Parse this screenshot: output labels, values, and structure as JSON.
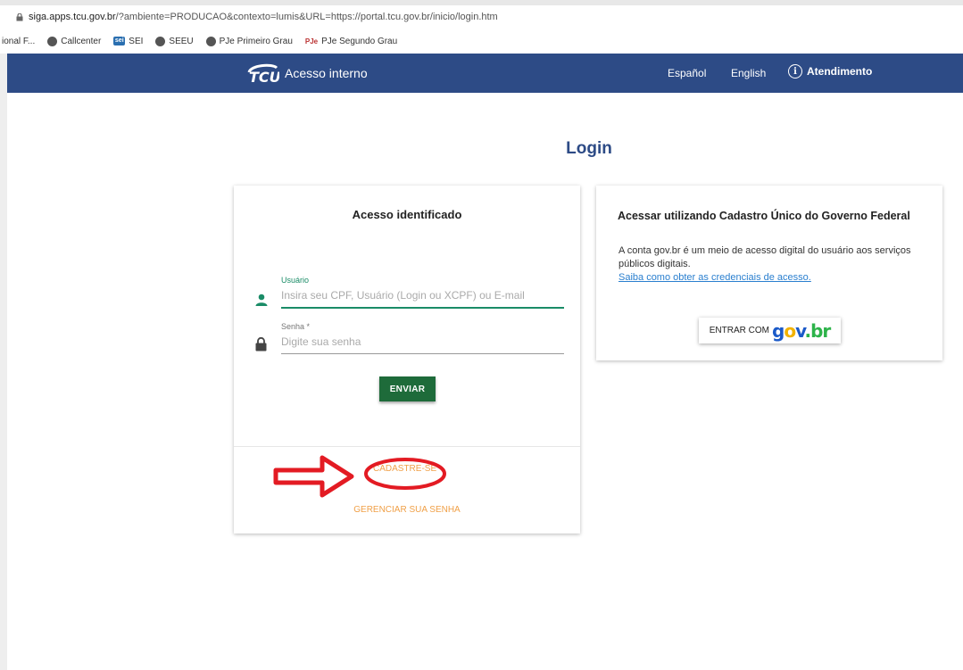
{
  "browser": {
    "url_host": "siga.apps.tcu.gov.br",
    "url_rest": "/?ambiente=PRODUCAO&contexto=lumis&URL=https://portal.tcu.gov.br/inicio/login.htm",
    "bookmarks": [
      "ional F...",
      "Callcenter",
      "SEI",
      "SEEU",
      "PJe Primeiro Grau",
      "PJe Segundo Grau"
    ]
  },
  "header": {
    "brand_text": "Acesso interno",
    "nav_es": "Español",
    "nav_en": "English",
    "nav_atendimento": "Atendimento",
    "color": "#2d4b86"
  },
  "page_title": "Login",
  "login_card": {
    "title": "Acesso identificado",
    "user_label": "Usuário",
    "user_placeholder": "Insira seu CPF, Usuário (Login ou XCPF) ou E-mail",
    "password_label": "Senha *",
    "password_placeholder": "Digite sua senha",
    "submit_label": "ENVIAR",
    "register_label": "CADASTRE-SE",
    "manage_label": "GERENCIAR SUA SENHA"
  },
  "govbr_card": {
    "title": "Acessar utilizando Cadastro Único do Governo Federal",
    "description": "A conta gov.br é um meio de acesso digital do usuário aos serviços públicos digitais.",
    "learn_link": "Saiba como obter as credenciais de acesso.",
    "button_label": "ENTRAR COM",
    "logo": {
      "p1": "g",
      "p2": "o",
      "p3": "v",
      "p4": ".br"
    }
  },
  "colors": {
    "accent_green": "#1e6b3a",
    "link_orange": "#f0a048",
    "annotation_red": "#e31b23"
  }
}
